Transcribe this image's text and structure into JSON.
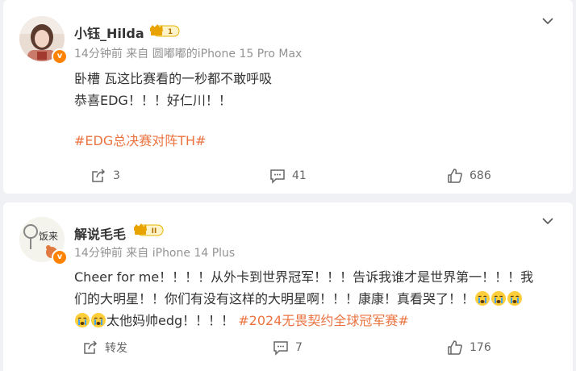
{
  "posts": [
    {
      "author": "小钰_Hilda",
      "level_badge": "1",
      "time": "14分钟前",
      "source": "来自 圆嘟嘟的iPhone 15 Pro Max",
      "lines": [
        "卧槽 瓦这比赛看的一秒都不敢呼吸",
        "恭喜EDG！！！好仁川！！"
      ],
      "hashtag": "#EDG总决赛对阵TH#",
      "repost_count": "3",
      "comment_count": "41",
      "like_count": "686"
    },
    {
      "author": "解说毛毛",
      "level_badge": "II",
      "avatar_text": "饭来",
      "time": "14分钟前",
      "source": "来自 iPhone 14 Plus",
      "line1": "Cheer for me！！！！从外卡到世界冠军！！！告诉我谁才是世界第一！！！我",
      "line2": "们的大明星！！你们有没有这样的大明星啊！！！康康！真看哭了！！",
      "line3": "太他妈帅edg！！！！",
      "hashtag": "#2024无畏契约全球冠军赛#",
      "repost_label": "转发",
      "comment_count": "7",
      "like_count": "176"
    }
  ],
  "colors": {
    "accent": "#ff8200",
    "hashtag": "#eb7340",
    "background": "#f0f1f4"
  }
}
